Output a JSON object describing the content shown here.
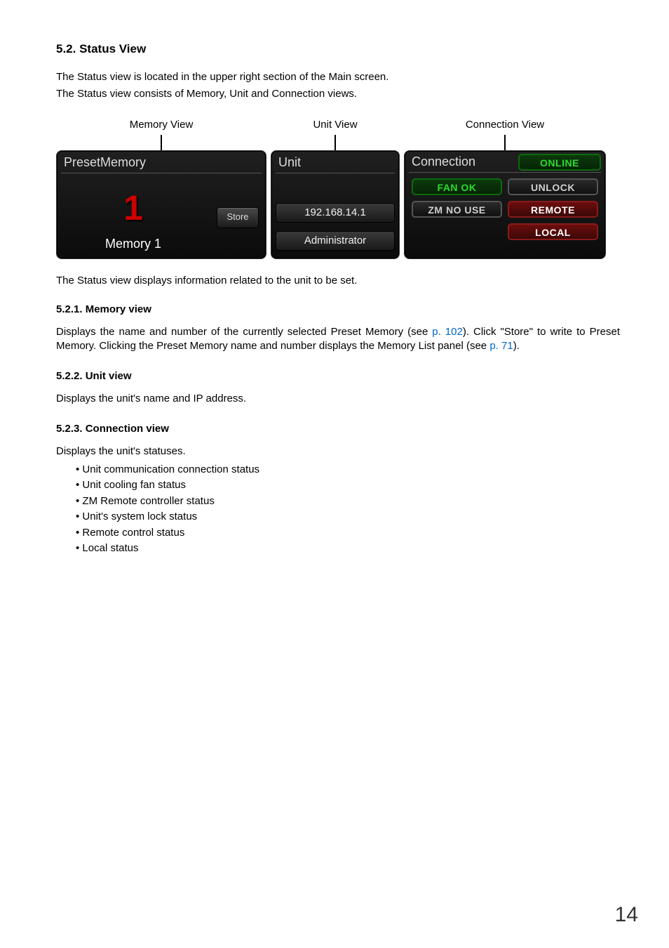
{
  "section": {
    "number": "5.2.",
    "title": "Status View",
    "intro_line1": "The Status view is located in the upper right section of the Main screen.",
    "intro_line2": "The Status view consists of Memory, Unit and Connection views."
  },
  "callouts": {
    "memory": "Memory View",
    "unit": "Unit View",
    "connection": "Connection View"
  },
  "figure": {
    "preset": {
      "header": "PresetMemory",
      "number": "1",
      "name": "Memory 1",
      "store_label": "Store"
    },
    "unit": {
      "header": "Unit",
      "ip": "192.168.14.1",
      "role": "Administrator"
    },
    "connection": {
      "header": "Connection",
      "online": "ONLINE",
      "fan": "FAN OK",
      "unlock": "UNLOCK",
      "zm": "ZM NO USE",
      "remote": "REMOTE",
      "local": "LOCAL"
    }
  },
  "post_figure": "The Status view displays information related to the unit to be set.",
  "subsections": {
    "memory": {
      "heading": "5.2.1. Memory view",
      "text_before_link1": "Displays the name and number of the currently selected Preset Memory (see ",
      "link1": "p. 102",
      "text_mid": "). Click \"Store\" to write to Preset Memory. Clicking the Preset Memory name and number displays the Memory List panel (see ",
      "link2": "p. 71",
      "text_after": ")."
    },
    "unit": {
      "heading": "5.2.2. Unit view",
      "text": "Displays the unit's name and IP address."
    },
    "connection": {
      "heading": "5.2.3. Connection view",
      "intro": "Displays the unit's statuses.",
      "items": [
        "Unit communication connection status",
        "Unit cooling fan status",
        "ZM Remote controller status",
        "Unit's system lock status",
        "Remote control status",
        "Local status"
      ]
    }
  },
  "page_number": "14"
}
